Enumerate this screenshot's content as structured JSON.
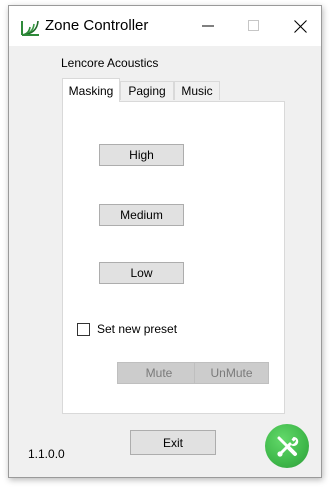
{
  "window": {
    "title": "Zone Controller"
  },
  "header": {
    "subtitle": "Lencore Acoustics"
  },
  "tabs": [
    {
      "label": "Masking",
      "active": true
    },
    {
      "label": "Paging",
      "active": false
    },
    {
      "label": "Music",
      "active": false
    }
  ],
  "masking": {
    "high_label": "High",
    "medium_label": "Medium",
    "low_label": "Low",
    "preset_checkbox": {
      "label": "Set new preset",
      "checked": false
    },
    "mute_label": "Mute",
    "unmute_label": "UnMute"
  },
  "footer": {
    "version": "1.1.0.0",
    "exit_label": "Exit"
  },
  "icons": {
    "app": "lencore-logo-icon",
    "settings": "wrench-screwdriver-icon",
    "settings_color": "#3fb84a"
  }
}
